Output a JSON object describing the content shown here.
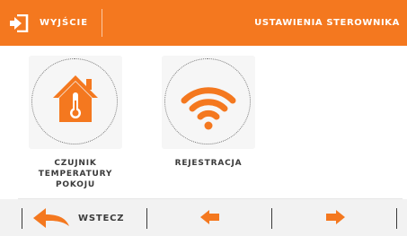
{
  "header": {
    "exit_label": "WYJŚCIE",
    "title": "USTAWIENIA STEROWNIKA"
  },
  "tiles": [
    {
      "label": "CZUJNIK\nTEMPERATURY\nPOKOJU",
      "icon": "house-thermometer-icon"
    },
    {
      "label": "REJESTRACJA",
      "icon": "wifi-icon"
    }
  ],
  "footer": {
    "back_label": "WSTECZ",
    "back_icon": "back-arrow-icon",
    "prev_icon": "arrow-left-icon",
    "next_icon": "arrow-right-icon"
  },
  "colors": {
    "accent": "#f4781f",
    "text": "#3a3a3a",
    "tile_background": "#f6f6f6",
    "footer_background": "#f2f2f2"
  }
}
